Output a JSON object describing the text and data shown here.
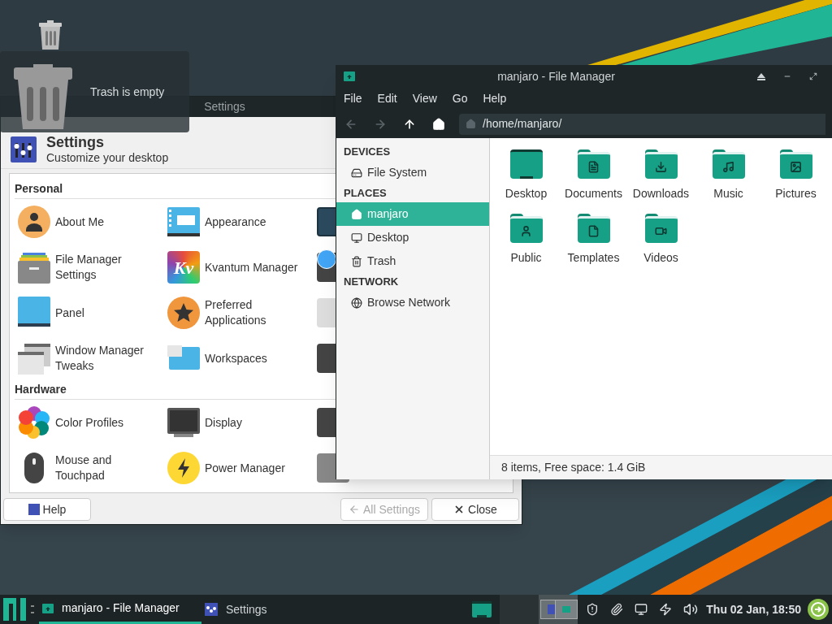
{
  "desktop": {
    "trash_tooltip": "Trash is empty"
  },
  "settings_window": {
    "title": "Settings",
    "heading": "Settings",
    "subtitle": "Customize your desktop",
    "sections": [
      {
        "title": "Personal",
        "items": [
          {
            "label": "About Me"
          },
          {
            "label": "Appearance"
          },
          {
            "label": "File Manager Settings"
          },
          {
            "label": "Kvantum Manager",
            "logo_text": "Kv"
          },
          {
            "label": "Panel"
          },
          {
            "label": "Preferred Applications"
          },
          {
            "label": "Window Manager Tweaks"
          },
          {
            "label": "Workspaces"
          }
        ]
      },
      {
        "title": "Hardware",
        "items": [
          {
            "label": "Color Profiles"
          },
          {
            "label": "Display"
          },
          {
            "label": "Mouse and Touchpad"
          },
          {
            "label": "Power Manager"
          }
        ]
      }
    ],
    "buttons": [
      {
        "kind": "help",
        "label": "Help",
        "disabled": false
      },
      {
        "kind": "back",
        "label": "All Settings",
        "disabled": true
      },
      {
        "kind": "close",
        "label": "Close",
        "disabled": false
      }
    ]
  },
  "file_manager": {
    "title": "manjaro - File Manager",
    "menu": [
      "File",
      "Edit",
      "View",
      "Go",
      "Help"
    ],
    "toolbar": [
      {
        "kind": "back",
        "disabled": true
      },
      {
        "kind": "forward",
        "disabled": true
      },
      {
        "kind": "up",
        "disabled": false
      },
      {
        "kind": "home",
        "disabled": false
      }
    ],
    "path": "/home/manjaro/",
    "sidebar": [
      {
        "title": "DEVICES",
        "items": [
          {
            "kind": "drive",
            "label": "File System",
            "selected": false
          }
        ]
      },
      {
        "title": "PLACES",
        "items": [
          {
            "kind": "home",
            "label": "manjaro",
            "selected": true
          },
          {
            "kind": "desktop",
            "label": "Desktop",
            "selected": false
          },
          {
            "kind": "trash",
            "label": "Trash",
            "selected": false
          }
        ]
      },
      {
        "title": "NETWORK",
        "items": [
          {
            "kind": "network",
            "label": "Browse Network",
            "selected": false
          }
        ]
      }
    ],
    "files": [
      {
        "kind": "desktop",
        "label": "Desktop"
      },
      {
        "kind": "documents",
        "label": "Documents"
      },
      {
        "kind": "downloads",
        "label": "Downloads"
      },
      {
        "kind": "music",
        "label": "Music"
      },
      {
        "kind": "pictures",
        "label": "Pictures"
      },
      {
        "kind": "public",
        "label": "Public"
      },
      {
        "kind": "templates",
        "label": "Templates"
      },
      {
        "kind": "videos",
        "label": "Videos"
      }
    ],
    "status": "8 items, Free space: 1.4 GiB"
  },
  "taskbar": {
    "tasks": [
      {
        "kind": "file-manager",
        "label": "manjaro - File Manager",
        "selected": true
      },
      {
        "kind": "settings",
        "label": "Settings",
        "selected": false
      }
    ],
    "clock": "Thu 02 Jan, 18:50"
  }
}
